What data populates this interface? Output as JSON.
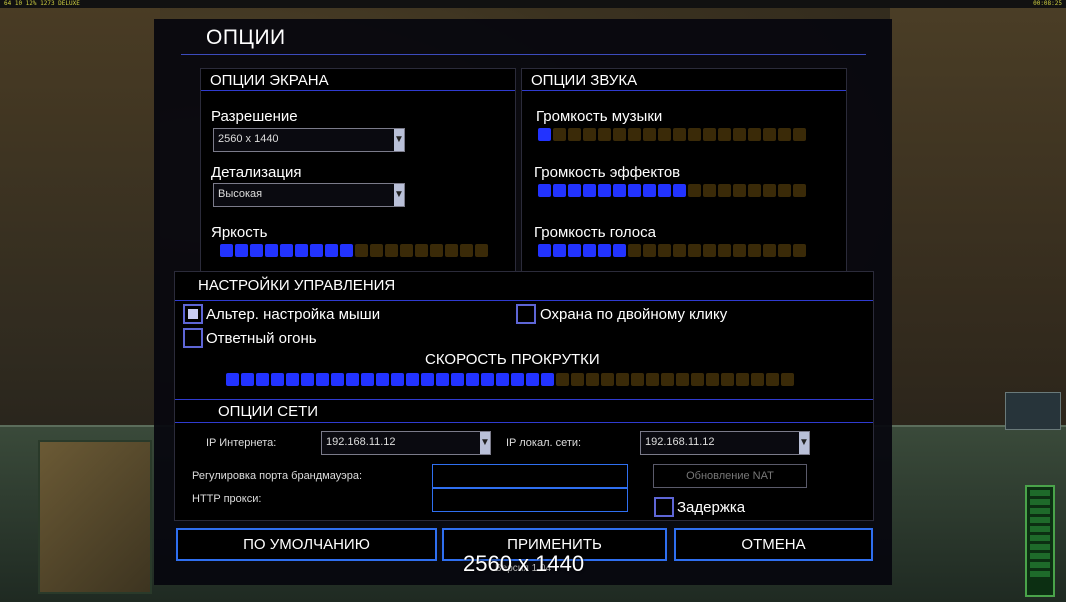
{
  "hud": {
    "left": "64 10 12% 1273 DELUXE",
    "right": "00:08:25"
  },
  "dialog": {
    "title": "ОПЦИИ"
  },
  "display": {
    "header": "ОПЦИИ ЭКРАНА",
    "resolution_label": "Разрешение",
    "resolution_value": "2560 x 1440",
    "detail_label": "Детализация",
    "detail_value": "Высокая",
    "brightness_label": "Яркость",
    "brightness_level": 9,
    "brightness_total": 18
  },
  "sound": {
    "header": "ОПЦИИ ЗВУКА",
    "music_label": "Громкость музыки",
    "music_level": 1,
    "effects_label": "Громкость эффектов",
    "effects_level": 10,
    "voice_label": "Громкость голоса",
    "voice_level": 6,
    "total": 18
  },
  "controls": {
    "header": "НАСТРОЙКИ УПРАВЛЕНИЯ",
    "alt_mouse_label": "Альтер. настройка мыши",
    "alt_mouse_checked": true,
    "double_click_label": "Охрана по двойному клику",
    "double_click_checked": false,
    "return_fire_label": "Ответный огонь",
    "return_fire_checked": false,
    "scroll_label": "СКОРОСТЬ ПРОКРУТКИ",
    "scroll_level": 22,
    "scroll_total": 38
  },
  "network": {
    "header": "ОПЦИИ СЕТИ",
    "internet_ip_label": "IP Интернета:",
    "internet_ip_value": "192.168.11.12",
    "lan_ip_label": "IP локал. сети:",
    "lan_ip_value": "192.168.11.12",
    "firewall_label": "Регулировка порта брандмауэра:",
    "firewall_value": "",
    "proxy_label": "HTTP прокси:",
    "proxy_value": "",
    "nat_button": "Обновление NAT",
    "delay_label": "Задержка",
    "delay_checked": false
  },
  "buttons": {
    "default": "ПО УМОЛЧАНИЮ",
    "apply": "ПРИМЕНИТЬ",
    "cancel": "ОТМЕНА"
  },
  "overlay_resolution": "2560 x 1440",
  "version": "Версия 1.04"
}
